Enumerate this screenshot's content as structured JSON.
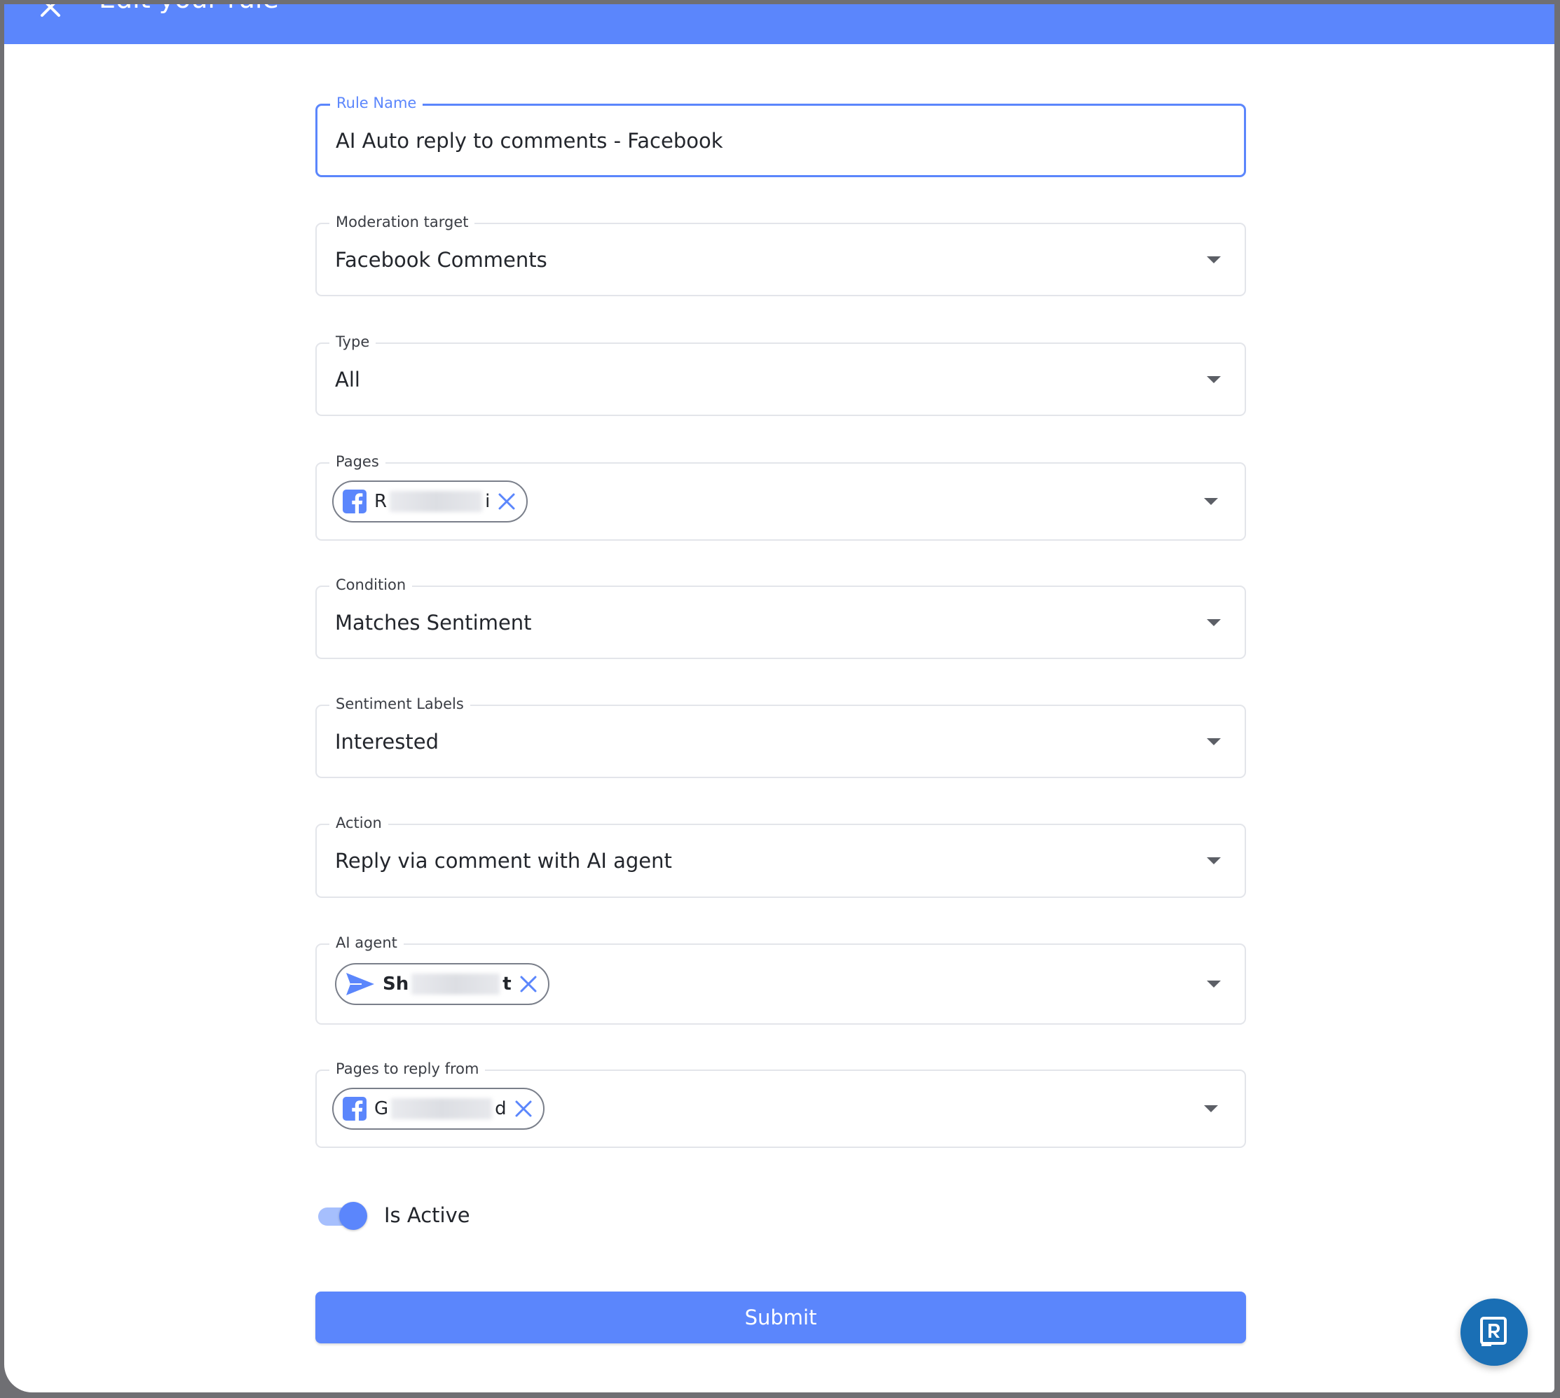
{
  "header": {
    "title": "Edit your rule",
    "close_icon": "close-icon"
  },
  "form": {
    "rule_name": {
      "label": "Rule Name",
      "value": "AI Auto reply to comments - Facebook"
    },
    "moderation_target": {
      "label": "Moderation target",
      "value": "Facebook Comments"
    },
    "type": {
      "label": "Type",
      "value": "All"
    },
    "pages": {
      "label": "Pages",
      "chip": {
        "icon": "facebook-icon",
        "prefix": "R",
        "suffix": "i"
      }
    },
    "condition": {
      "label": "Condition",
      "value": "Matches Sentiment"
    },
    "sentiment_labels": {
      "label": "Sentiment Labels",
      "value": "Interested"
    },
    "action": {
      "label": "Action",
      "value": "Reply via comment with AI agent"
    },
    "ai_agent": {
      "label": "AI agent",
      "chip": {
        "icon": "send-icon",
        "prefix": "Sh",
        "suffix": "t"
      }
    },
    "pages_to_reply_from": {
      "label": "Pages to reply from",
      "chip": {
        "icon": "facebook-icon",
        "prefix": "G",
        "suffix": "d"
      }
    },
    "is_active": {
      "label": "Is Active",
      "checked": true
    },
    "submit_label": "Submit"
  },
  "colors": {
    "primary": "#5b86fc",
    "toggle_track": "#a6bffd",
    "fab": "#1a6fb5"
  }
}
